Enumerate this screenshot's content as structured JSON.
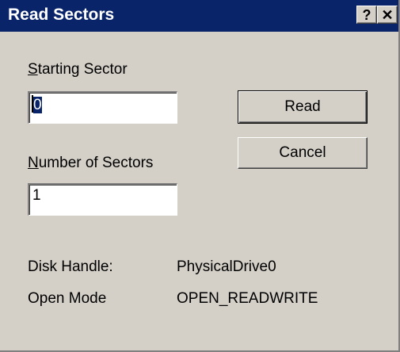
{
  "window": {
    "title": "Read Sectors",
    "help_glyph": "?",
    "close_glyph": "✕"
  },
  "form": {
    "starting_sector_label_accel": "S",
    "starting_sector_label_rest": "tarting Sector",
    "starting_sector_value": "0",
    "sector_count_label_accel": "N",
    "sector_count_label_rest": "umber of Sectors",
    "sector_count_value": "1"
  },
  "buttons": {
    "read_label": "Read",
    "cancel_label": "Cancel"
  },
  "info": {
    "disk_handle_label": "Disk Handle:",
    "disk_handle_value": "PhysicalDrive0",
    "open_mode_label": "Open Mode",
    "open_mode_value": "OPEN_READWRITE"
  },
  "colors": {
    "titlebar": "#0a246a",
    "dialog_face": "#d4d0c8",
    "field_bg": "#ffffff"
  }
}
